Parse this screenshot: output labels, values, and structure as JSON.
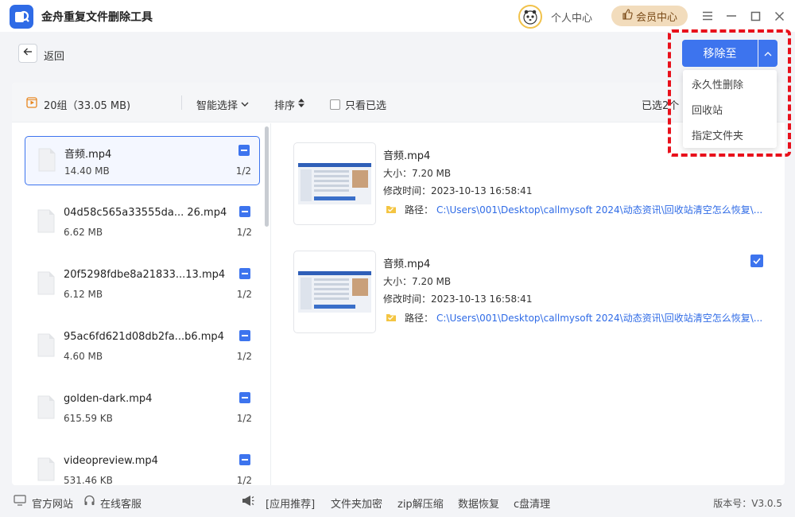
{
  "app": {
    "title": "金舟重复文件删除工具",
    "personal_center": "个人中心",
    "vip_center": "会员中心"
  },
  "nav": {
    "back_label": "返回"
  },
  "actions": {
    "move_to": "移除至",
    "menu": [
      "永久性删除",
      "回收站",
      "指定文件夹"
    ]
  },
  "toolbar": {
    "group_summary": "20组（33.05 MB)",
    "smart_select": "智能选择",
    "sort": "排序",
    "only_selected": "只看已选",
    "selected_count": "已选2个"
  },
  "file_list": [
    {
      "name": "音频.mp4",
      "size": "14.40 MB",
      "count": "1/2"
    },
    {
      "name": "04d58c565a33555da... 26.mp4",
      "size": "6.62 MB",
      "count": "1/2"
    },
    {
      "name": "20f5298fdbe8a21833...13.mp4",
      "size": "6.12 MB",
      "count": "1/2"
    },
    {
      "name": "95ac6fd621d08db2fa...b6.mp4",
      "size": "4.60 MB",
      "count": "1/2"
    },
    {
      "name": "golden-dark.mp4",
      "size": "615.59 KB",
      "count": "1/2"
    },
    {
      "name": "videopreview.mp4",
      "size": "531.46 KB",
      "count": "1/2"
    }
  ],
  "details": [
    {
      "name": "音频.mp4",
      "size": "大小：7.20 MB",
      "time": "修改时间：2023-10-13 16:58:41",
      "path_label": "路径：",
      "path": "C:\\Users\\001\\Desktop\\callmysoft 2024\\动态资讯\\回收站清空怎么恢复\\..."
    },
    {
      "name": "音频.mp4",
      "size": "大小：7.20 MB",
      "time": "修改时间：2023-10-13 16:58:41",
      "path_label": "路径：",
      "path": "C:\\Users\\001\\Desktop\\callmysoft 2024\\动态资讯\\回收站清空怎么恢复\\..."
    }
  ],
  "footer": {
    "website": "官方网站",
    "service": "在线客服",
    "app_recommend": "[应用推荐]",
    "folder_encrypt": "文件夹加密",
    "zip": "zip解压缩",
    "data_recovery": "数据恢复",
    "c_clean": "c盘清理",
    "version": "版本号：V3.0.5"
  },
  "colors": {
    "accent": "#3d74ee",
    "highlight": "#e8101b",
    "vip": "#f2dcbc",
    "link": "#2f6be6"
  }
}
